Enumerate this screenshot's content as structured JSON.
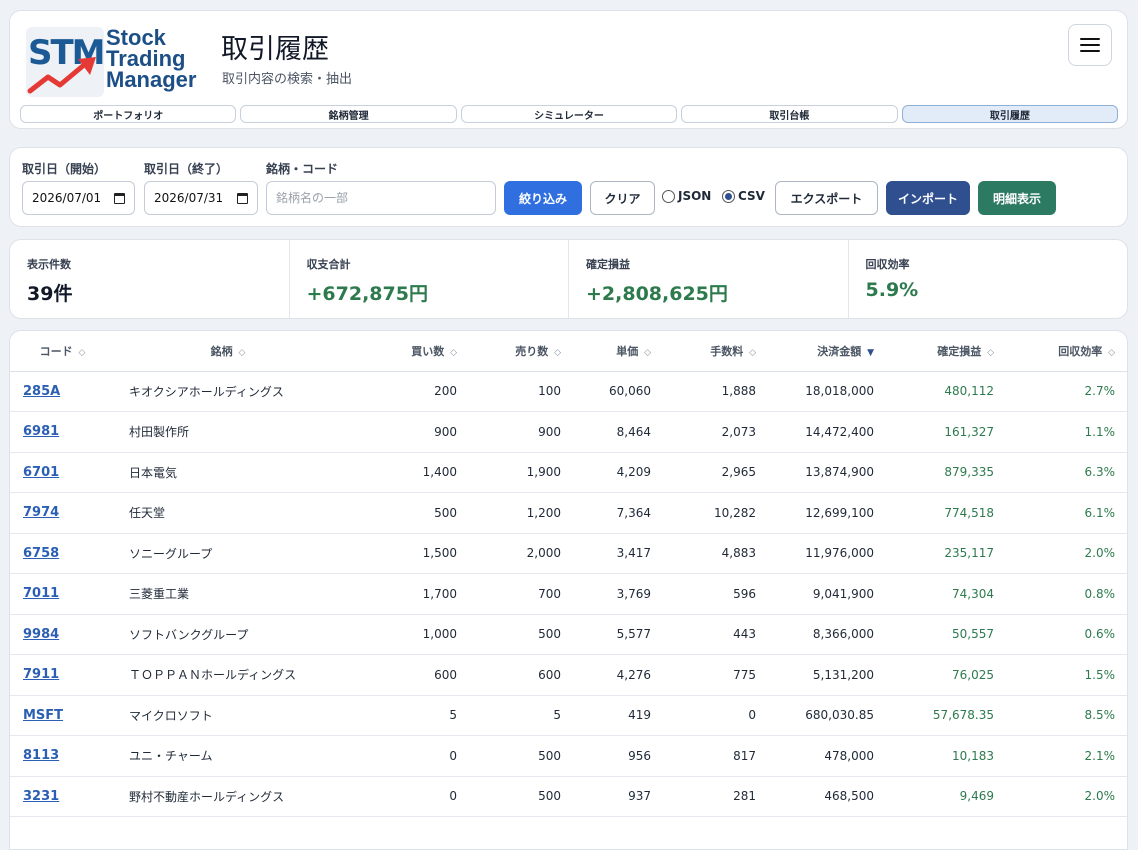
{
  "app": {
    "logo_line1": "Stock",
    "logo_line2": "Trading",
    "logo_line3": "Manager",
    "logo_mark": "STM",
    "title": "取引履歴",
    "subtitle": "取引内容の検索・抽出",
    "menu_icon": "hamburger-icon"
  },
  "tabs": [
    {
      "label": "ポートフォリオ",
      "active": false
    },
    {
      "label": "銘柄管理",
      "active": false
    },
    {
      "label": "シミュレーター",
      "active": false
    },
    {
      "label": "取引台帳",
      "active": false
    },
    {
      "label": "取引履歴",
      "active": true
    }
  ],
  "filter": {
    "start_label": "取引日（開始）",
    "start_value": "2026/07/01",
    "end_label": "取引日（終了）",
    "end_value": "2026/07/31",
    "stock_label": "銘柄・コード",
    "stock_placeholder": "銘柄名の一部",
    "filter_button": "絞り込み",
    "clear_button": "クリア",
    "format_json": "JSON",
    "format_csv": "CSV",
    "selected_format": "CSV",
    "export_button": "エクスポート",
    "import_button": "インポート",
    "detail_button": "明細表示"
  },
  "stats": [
    {
      "label": "表示件数",
      "value": "39件",
      "positive": false
    },
    {
      "label": "収支合計",
      "value": "+672,875円",
      "positive": true
    },
    {
      "label": "確定損益",
      "value": "+2,808,625円",
      "positive": true
    },
    {
      "label": "回収効率",
      "value": "5.9%",
      "positive": true
    }
  ],
  "table": {
    "headers": [
      "コード",
      "銘柄",
      "買い数",
      "売り数",
      "単価",
      "手数料",
      "決済金額",
      "確定損益",
      "回収効率"
    ],
    "sorted_column": "決済金額",
    "sort_icon": "◇",
    "sorted_icon": "▼",
    "rows": [
      [
        "285A",
        "キオクシアホールディングス",
        "200",
        "100",
        "60,060",
        "1,888",
        "18,018,000",
        "480,112",
        "2.7%"
      ],
      [
        "6981",
        "村田製作所",
        "900",
        "900",
        "8,464",
        "2,073",
        "14,472,400",
        "161,327",
        "1.1%"
      ],
      [
        "6701",
        "日本電気",
        "1,400",
        "1,900",
        "4,209",
        "2,965",
        "13,874,900",
        "879,335",
        "6.3%"
      ],
      [
        "7974",
        "任天堂",
        "500",
        "1,200",
        "7,364",
        "10,282",
        "12,699,100",
        "774,518",
        "6.1%"
      ],
      [
        "6758",
        "ソニーグループ",
        "1,500",
        "2,000",
        "3,417",
        "4,883",
        "11,976,000",
        "235,117",
        "2.0%"
      ],
      [
        "7011",
        "三菱重工業",
        "1,700",
        "700",
        "3,769",
        "596",
        "9,041,900",
        "74,304",
        "0.8%"
      ],
      [
        "9984",
        "ソフトバンクグループ",
        "1,000",
        "500",
        "5,577",
        "443",
        "8,366,000",
        "50,557",
        "0.6%"
      ],
      [
        "7911",
        "ＴＯＰＰＡＮホールディングス",
        "600",
        "600",
        "4,276",
        "775",
        "5,131,200",
        "76,025",
        "1.5%"
      ],
      [
        "MSFT",
        "マイクロソフト",
        "5",
        "5",
        "419",
        "0",
        "680,030.85",
        "57,678.35",
        "8.5%"
      ],
      [
        "8113",
        "ユニ・チャーム",
        "0",
        "500",
        "956",
        "817",
        "478,000",
        "10,183",
        "2.1%"
      ],
      [
        "3231",
        "野村不動産ホールディングス",
        "0",
        "500",
        "937",
        "281",
        "468,500",
        "9,469",
        "2.0%"
      ]
    ]
  },
  "colors": {
    "primary": "#2f6fe0",
    "navy": "#2f4f8f",
    "green": "#2d7a63",
    "positive_text": "#2d7a4d",
    "link": "#2b5fb3"
  }
}
